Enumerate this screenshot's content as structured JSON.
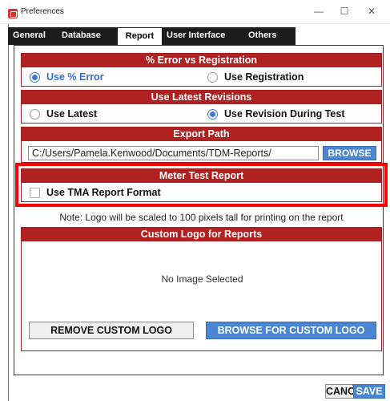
{
  "window": {
    "title": "Preferences",
    "minimize": "—",
    "maximize": "☐",
    "close": "✕"
  },
  "tabs": [
    {
      "label": "General"
    },
    {
      "label": "Database"
    },
    {
      "label": "Report"
    },
    {
      "label": "User Interface"
    },
    {
      "label": "Others"
    }
  ],
  "active_tab": "Report",
  "error_section": {
    "title": "% Error vs Registration",
    "options": [
      {
        "label": "Use % Error",
        "selected": true
      },
      {
        "label": "Use Registration",
        "selected": false
      }
    ]
  },
  "revisions_section": {
    "title": "Use Latest Revisions",
    "options": [
      {
        "label": "Use Latest",
        "selected": false
      },
      {
        "label": "Use Revision During Test",
        "selected": true
      }
    ]
  },
  "export_section": {
    "title": "Export Path",
    "path_value": "C:/Users/Pamela.Kenwood/Documents/TDM-Reports/",
    "browse_label": "BROWSE"
  },
  "meter_section": {
    "title": "Meter Test Report",
    "checkbox_label": "Use TMA Report Format",
    "checked": false
  },
  "note": "Note: Logo will be scaled to 100 pixels tall for printing on the report",
  "logo_section": {
    "title": "Custom Logo for Reports",
    "no_image_text": "No Image Selected",
    "remove_label": "REMOVE CUSTOM LOGO",
    "browse_label": "BROWSE FOR CUSTOM LOGO"
  },
  "footer": {
    "cancel_label": "CANCEL",
    "save_label": "SAVE"
  },
  "colors": {
    "accent_red": "#b02222",
    "accent_blue": "#4a86d4",
    "highlight": "#ff0000"
  }
}
